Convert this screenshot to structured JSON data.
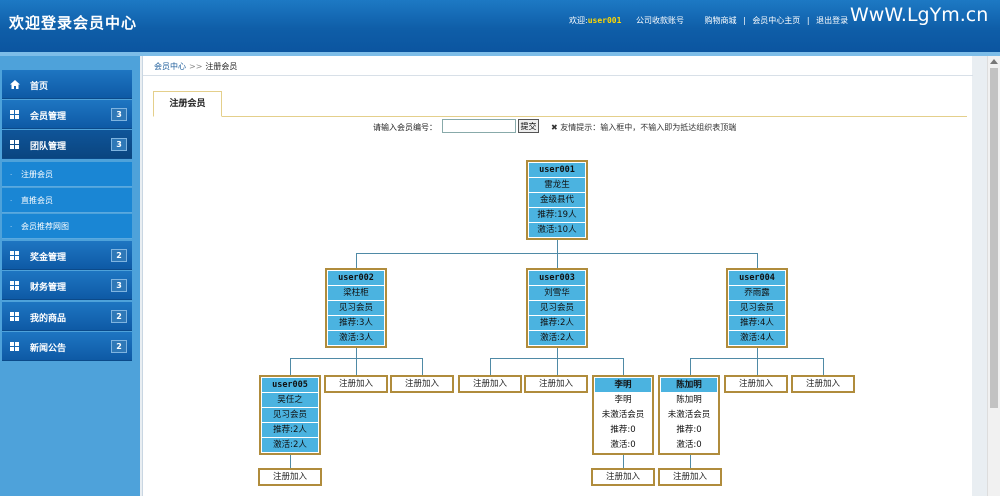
{
  "header": {
    "title": "欢迎登录会员中心",
    "welcome": "欢迎:",
    "username": "user001",
    "links": [
      "公司收款账号",
      "购物商城",
      "会员中心主页",
      "退出登录"
    ],
    "separator": "|",
    "logo": "WwW.LgYm.cn"
  },
  "sidebar": {
    "menus": [
      {
        "label": "首页",
        "icon": "home-icon",
        "badge": ""
      },
      {
        "label": "会员管理",
        "icon": "grid-icon",
        "badge": "3"
      },
      {
        "label": "团队管理",
        "icon": "grid-icon",
        "badge": "3"
      },
      {
        "label": "奖金管理",
        "icon": "grid-icon",
        "badge": "2"
      },
      {
        "label": "财务管理",
        "icon": "grid-icon",
        "badge": "3"
      },
      {
        "label": "我的商品",
        "icon": "grid-icon",
        "badge": "2"
      },
      {
        "label": "新闻公告",
        "icon": "grid-icon",
        "badge": "2"
      }
    ],
    "submenus": [
      "注册会员",
      "直推会员",
      "会员推荐网图"
    ],
    "sub_bullet": "·"
  },
  "breadcrumb": {
    "root": "会员中心",
    "sep": ">>",
    "current": "注册会员"
  },
  "tab": {
    "label": "注册会员"
  },
  "form": {
    "label": "请输入会员编号：",
    "input_value": "",
    "submit": "提交",
    "tip": "✖ 友情提示：输入框中，不输入即为抵达组织表顶端"
  },
  "tree": {
    "register_label": "注册加入",
    "nodes": {
      "root": {
        "id": "user001",
        "name": "雷龙生",
        "level": "金级县代",
        "recommend": "推荐:19人",
        "active": "激活:10人"
      },
      "a": {
        "id": "user002",
        "name": "梁柱柜",
        "level": "见习会员",
        "recommend": "推荐:3人",
        "active": "激活:3人"
      },
      "b": {
        "id": "user003",
        "name": "刘雪华",
        "level": "见习会员",
        "recommend": "推荐:2人",
        "active": "激活:2人"
      },
      "c": {
        "id": "user004",
        "name": "乔雨露",
        "level": "见习会员",
        "recommend": "推荐:4人",
        "active": "激活:4人"
      },
      "a1": {
        "id": "user005",
        "name": "吴任之",
        "level": "见习会员",
        "recommend": "推荐:2人",
        "active": "激活:2人"
      },
      "b3": {
        "id": "李明",
        "name": "李明",
        "level": "未激活会员",
        "recommend": "推荐:0",
        "active": "激活:0"
      },
      "c1": {
        "id": "陈加明",
        "name": "陈加明",
        "level": "未激活会员",
        "recommend": "推荐:0",
        "active": "激活:0"
      }
    }
  }
}
